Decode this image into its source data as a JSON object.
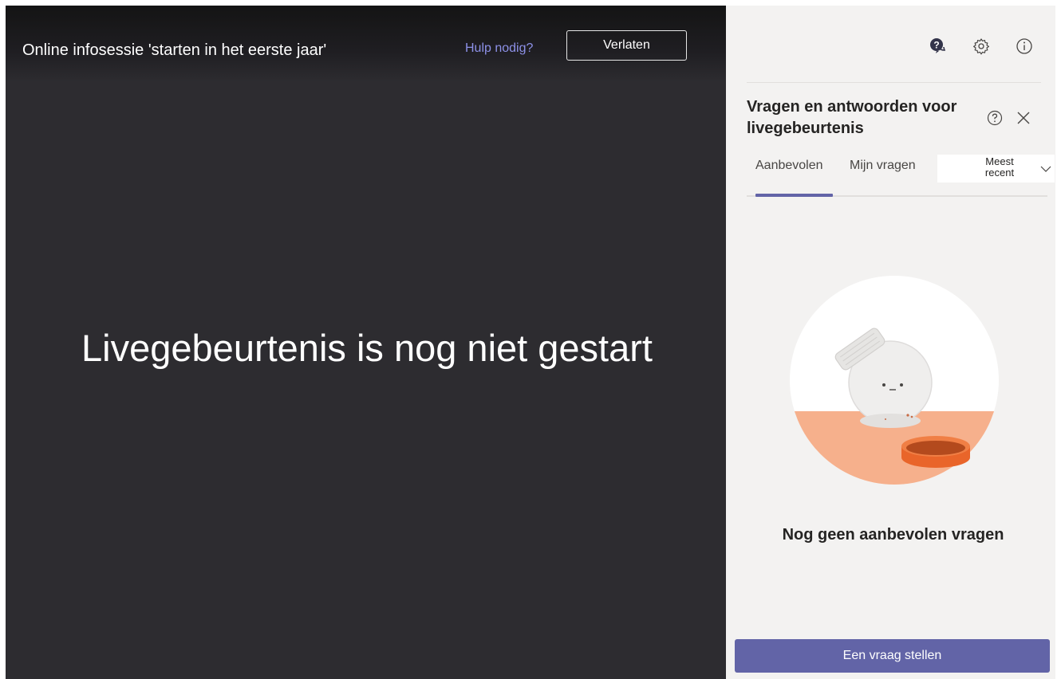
{
  "stage": {
    "event_title": "Online infosessie 'starten in het eerste jaar'",
    "help_link": "Hulp nodig?",
    "leave_button": "Verlaten",
    "status_message": "Livegebeurtenis is nog niet gestart"
  },
  "panel": {
    "top_icons": [
      "qa-chat-icon",
      "gear-icon",
      "info-icon"
    ],
    "title": "Vragen en antwoorden voor livegebeurtenis",
    "tabs": [
      {
        "label": "Aanbevolen",
        "selected": true
      },
      {
        "label": "Mijn vragen",
        "selected": false
      }
    ],
    "sort": {
      "selected": "Meest recent"
    },
    "empty_state": "Nog geen aanbevolen vragen",
    "ask_button": "Een vraag stellen"
  },
  "colors": {
    "stage_background": "#2d2c30",
    "panel_background": "#f3f2f1",
    "accent": "#6264a7",
    "link": "#8d91e8",
    "illustration_orange": "#e9652a"
  }
}
